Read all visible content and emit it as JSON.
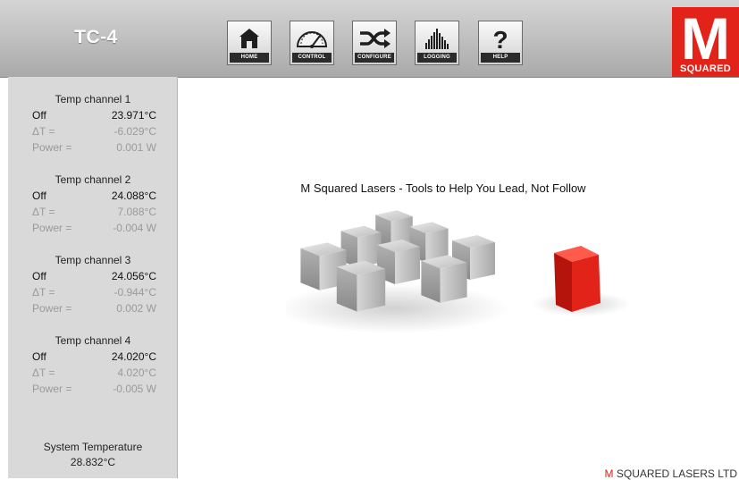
{
  "app": {
    "title": "TC-4"
  },
  "nav": {
    "home": "HOME",
    "control": "CONTROL",
    "configure": "CONFIGURE",
    "logging": "LOGGING",
    "help": "HELP"
  },
  "logo": {
    "letter": "M",
    "text": "SQUARED"
  },
  "channels": [
    {
      "title": "Temp channel 1",
      "state": "Off",
      "temp": "23.971°C",
      "dt_label": "ΔT =",
      "dt": "-6.029°C",
      "power_label": "Power =",
      "power": "0.001 W"
    },
    {
      "title": "Temp channel 2",
      "state": "Off",
      "temp": "24.088°C",
      "dt_label": "ΔT =",
      "dt": "7.088°C",
      "power_label": "Power =",
      "power": "-0.004 W"
    },
    {
      "title": "Temp channel 3",
      "state": "Off",
      "temp": "24.056°C",
      "dt_label": "ΔT =",
      "dt": "-0.944°C",
      "power_label": "Power =",
      "power": "0.002 W"
    },
    {
      "title": "Temp channel 4",
      "state": "Off",
      "temp": "24.020°C",
      "dt_label": "ΔT =",
      "dt": "4.020°C",
      "power_label": "Power =",
      "power": "-0.005 W"
    }
  ],
  "system": {
    "label": "System Temperature",
    "value": "28.832°C"
  },
  "main": {
    "tagline": "M Squared Lasers - Tools to Help You Lead, Not Follow"
  },
  "footer": {
    "m": "M",
    "rest": " SQUARED LASERS LTD"
  },
  "colors": {
    "brand_red": "#e2231a",
    "sidebar_bg": "#d9d9d9",
    "dim_text": "#9a9a9a"
  }
}
